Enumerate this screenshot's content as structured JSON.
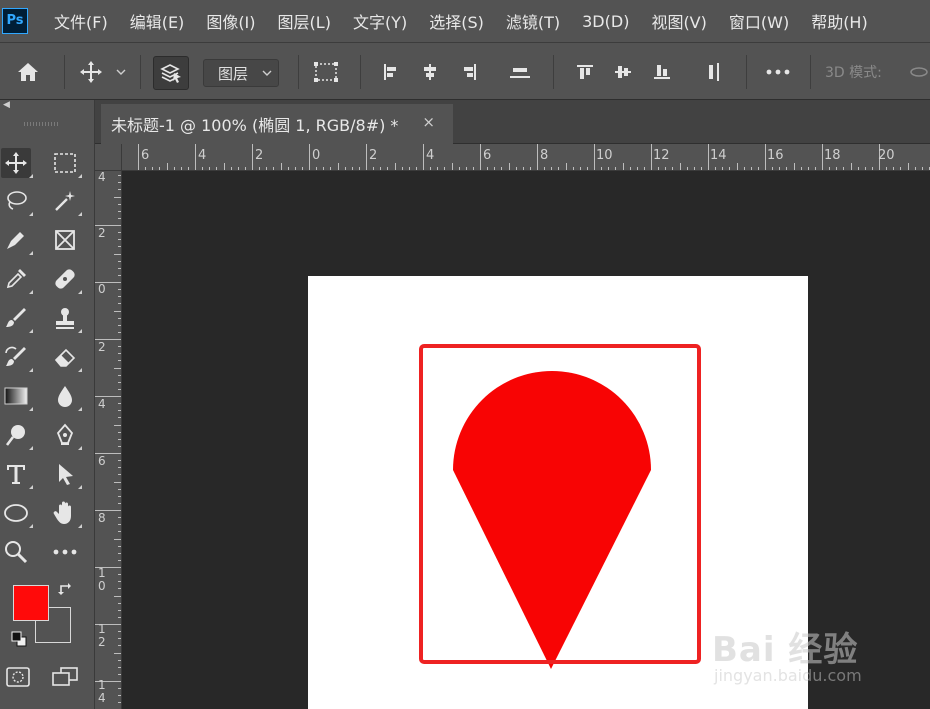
{
  "app": {
    "logo": "Ps"
  },
  "menu": {
    "items": [
      "文件(F)",
      "编辑(E)",
      "图像(I)",
      "图层(L)",
      "文字(Y)",
      "选择(S)",
      "滤镜(T)",
      "3D(D)",
      "视图(V)",
      "窗口(W)",
      "帮助(H)"
    ]
  },
  "options": {
    "auto_select_target": "图层",
    "mode_3d_label": "3D 模式:"
  },
  "document": {
    "tab_title": "未标题-1 @ 100% (椭圆 1, RGB/8#) *",
    "close_glyph": "×"
  },
  "rulers": {
    "horizontal": [
      "6",
      "4",
      "2",
      "0",
      "2",
      "4",
      "6",
      "8",
      "10",
      "12",
      "14",
      "16",
      "18",
      "20"
    ],
    "vertical": [
      "4",
      "2",
      "0",
      "2",
      "4",
      "6",
      "8",
      "1\n0",
      "1\n2",
      "1\n4"
    ]
  },
  "colors": {
    "foreground": "#ff0a0a",
    "shape_fill": "#f80404",
    "selection_stroke": "#ee2222"
  },
  "watermark": {
    "main": "Bai 经验",
    "sub": "jingyan.baidu.com"
  }
}
